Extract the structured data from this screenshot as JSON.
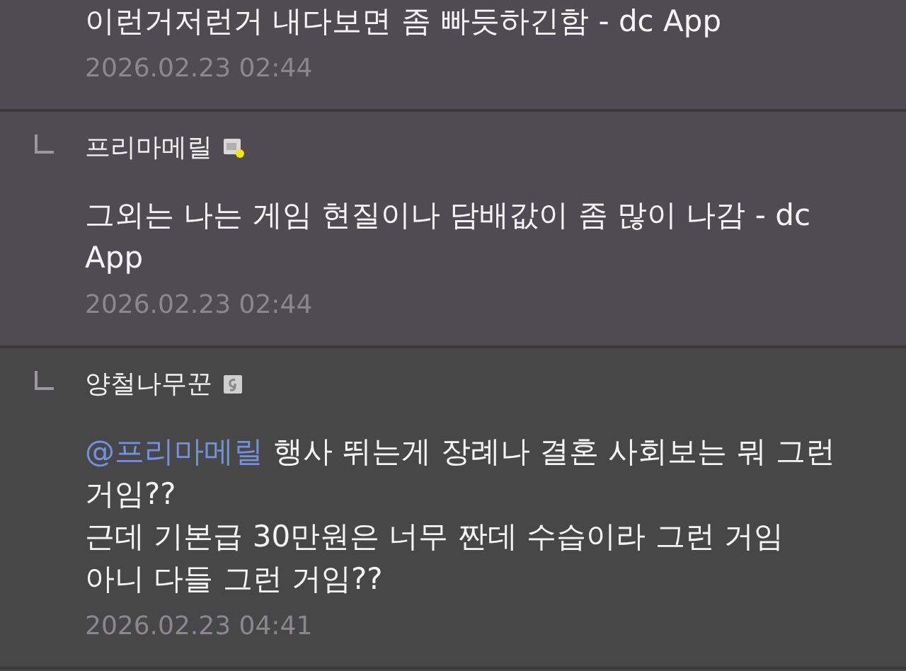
{
  "comments": [
    {
      "kind": "comment",
      "highlighted": true,
      "lines": [
        {
          "text": "이런거저런거 내다보면 좀 빠듯하긴함 - dc App"
        }
      ],
      "date": "2026.02.23 02:44"
    },
    {
      "kind": "reply",
      "highlighted": true,
      "author": "프리마메릴",
      "badge": {
        "kind": "fixed"
      },
      "lines": [
        {
          "text": "그외는 나는 게임 현질이나 담배값이 좀 많이 나감 - dc"
        },
        {
          "text": "App"
        }
      ],
      "date": "2026.02.23 02:44"
    },
    {
      "kind": "reply",
      "highlighted": false,
      "author": "양철나무꾼",
      "badge": {
        "kind": "half"
      },
      "lines": [
        {
          "mention": "@프리마메릴",
          "text": "행사 뛰는게 장례나 결혼 사회보는 뭐 그런"
        },
        {
          "text": "거임??"
        },
        {
          "text": "근데 기본급 30만원은 너무 짠데 수습이라 그런 거임"
        },
        {
          "text": "아니 다들 그런 거임??"
        }
      ],
      "date": "2026.02.23 04:41"
    }
  ]
}
